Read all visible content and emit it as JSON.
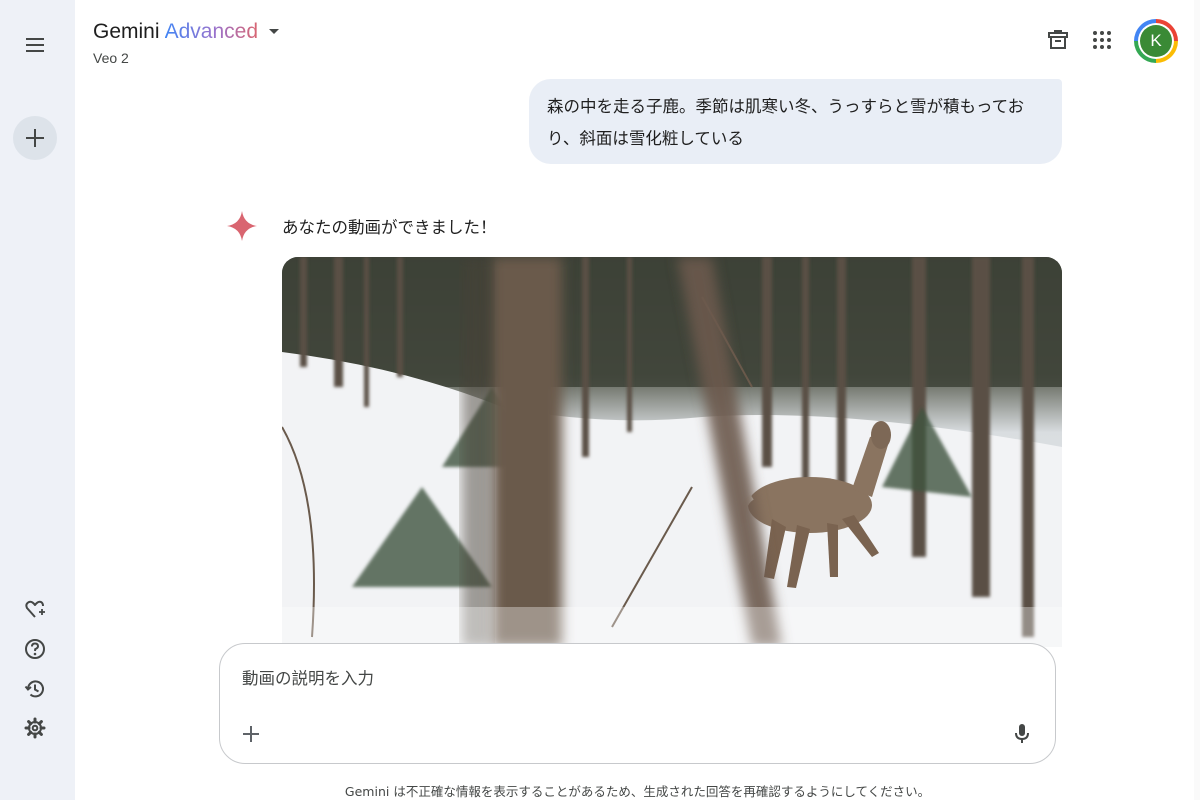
{
  "header": {
    "brand_main": "Gemini",
    "brand_tier": "Advanced",
    "model_name": "Veo 2",
    "avatar_initial": "K"
  },
  "conversation": {
    "user_prompt": "森の中を走る子鹿。季節は肌寒い冬、うっすらと雪が積もっており、斜面は雪化粧している",
    "response_text": "あなたの動画ができました！"
  },
  "composer": {
    "placeholder": "動画の説明を入力"
  },
  "footer": {
    "disclaimer": "Gemini は不正確な情報を表示することがあるため、生成された回答を再確認するようにしてください。"
  },
  "icons": {
    "sidebar_top": [
      "menu-icon",
      "plus-icon"
    ],
    "sidebar_bottom": [
      "gem-icon",
      "help-icon",
      "history-icon",
      "settings-icon"
    ],
    "header": [
      "chevron-down-icon",
      "cast-icon",
      "apps-icon"
    ],
    "composer": [
      "plus-icon",
      "microphone-icon"
    ]
  },
  "colors": {
    "sidebar_bg": "#eef1f7",
    "bubble_bg": "#e9eef6",
    "spark": "#d96570",
    "avatar_bg": "#3a8a35"
  }
}
